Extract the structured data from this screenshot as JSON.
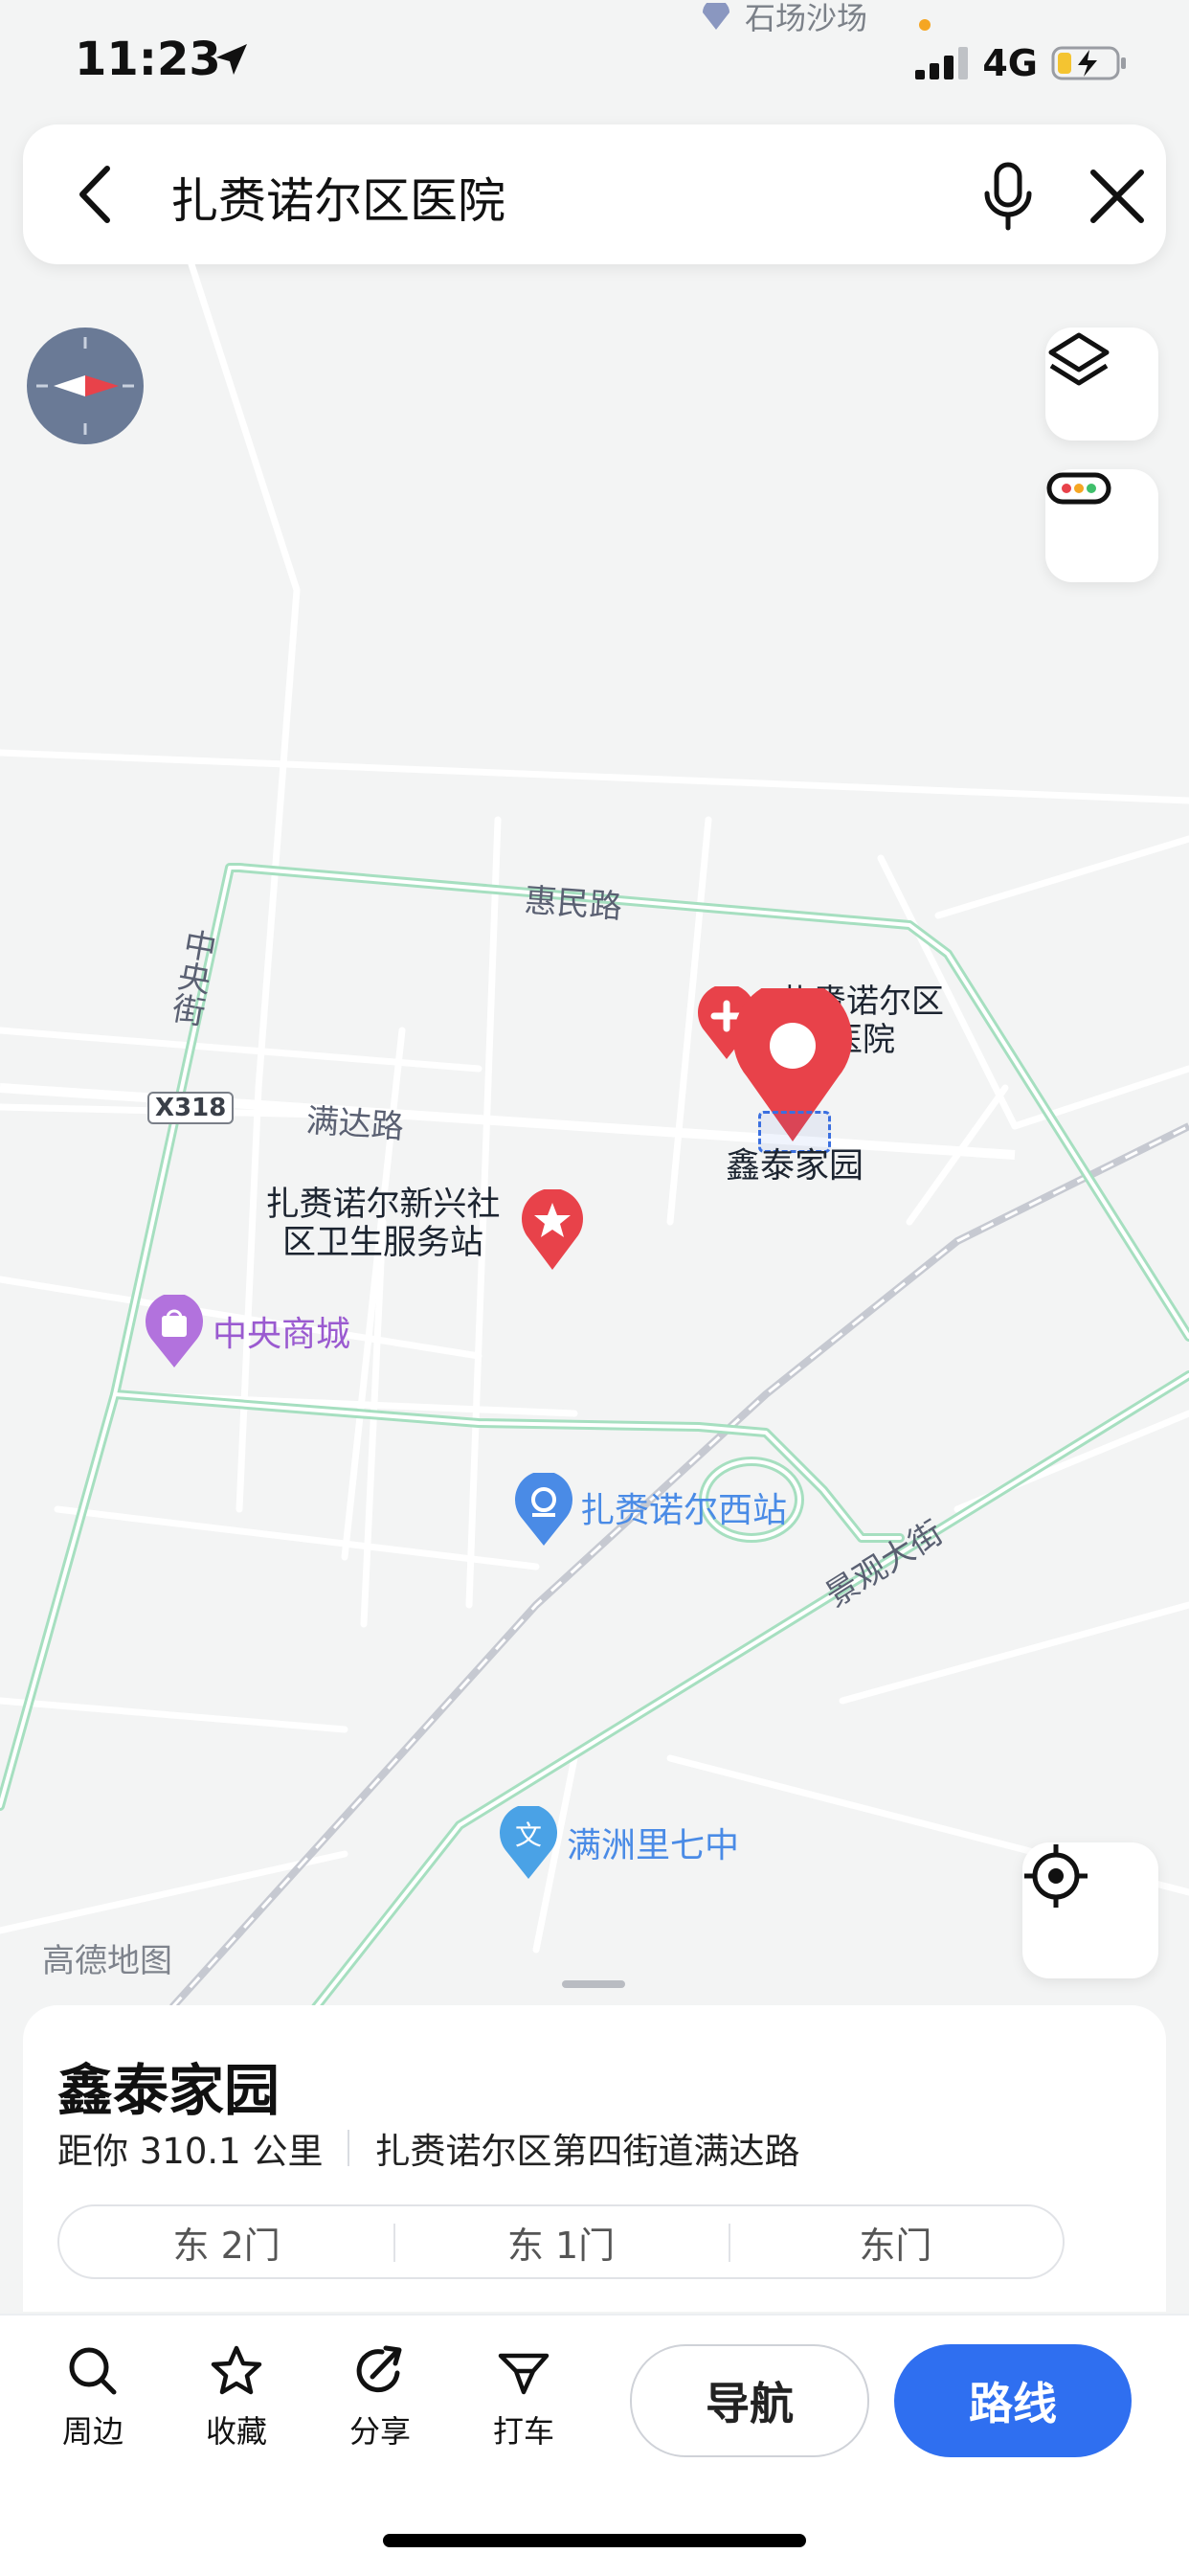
{
  "status_bar": {
    "time": "11:23",
    "network": "4G",
    "top_poi": "石场沙场"
  },
  "search": {
    "query": "扎赉诺尔区医院"
  },
  "map": {
    "roads": {
      "huimin": "惠民路",
      "zhongyang": "中央街",
      "manda": "满达路",
      "x318": "X318",
      "jingguan": "景观大街"
    },
    "pois": {
      "hospital": "扎赉诺尔区医院",
      "xintai": "鑫泰家园",
      "health_station": "扎赉诺尔新兴社区卫生服务站",
      "mall": "中央商城",
      "west_station": "扎赉诺尔西站",
      "school": "满洲里七中"
    },
    "logo": "高德地图"
  },
  "place": {
    "title": "鑫泰家园",
    "distance": "距你 310.1 公里",
    "address": "扎赉诺尔区第四街道满达路",
    "gates": [
      "东 2门",
      "东 1门",
      "东门"
    ]
  },
  "actions": {
    "nearby": "周边",
    "favorite": "收藏",
    "share": "分享",
    "taxi": "打车",
    "navigate": "导航",
    "route": "路线"
  },
  "colors": {
    "accent": "#2f6ff0",
    "pin": "#e8424a",
    "main_road": "#a6dfc0",
    "poi_blue": "#4a8be6",
    "poi_purple": "#9a5ad0"
  }
}
